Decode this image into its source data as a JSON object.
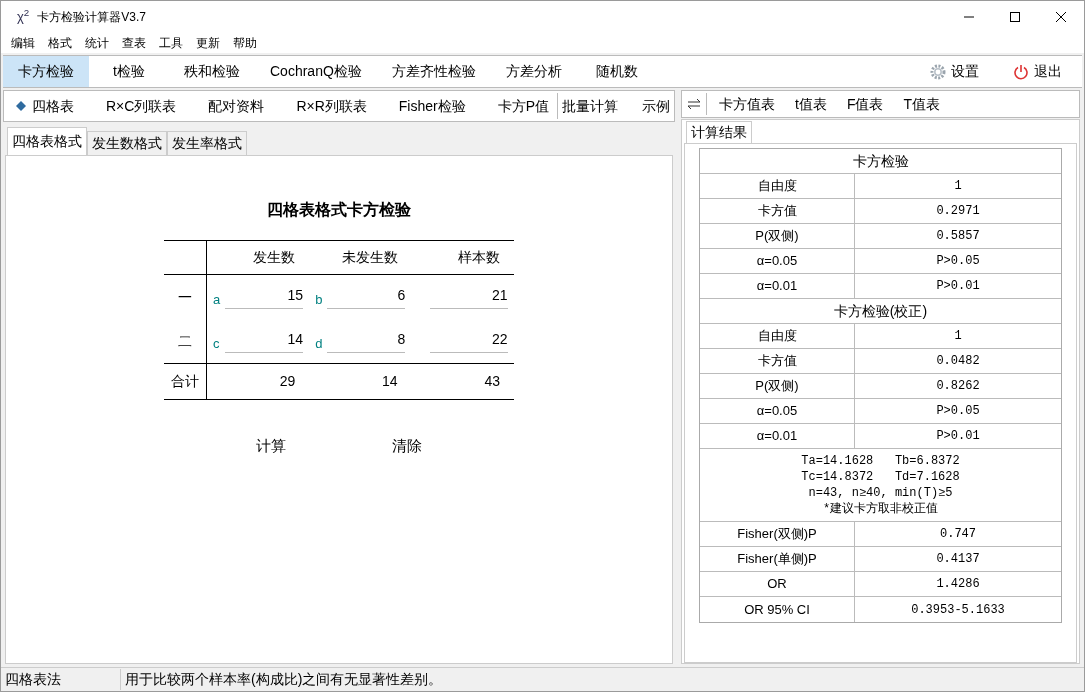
{
  "window": {
    "icon": "χ$^{2}$",
    "title": "卡方检验计算器V3.7"
  },
  "menu": [
    "编辑",
    "格式",
    "统计",
    "查表",
    "工具",
    "更新",
    "帮助"
  ],
  "main_tabs": [
    {
      "label": "卡方检验",
      "selected": true
    },
    {
      "label": "t检验",
      "selected": false
    },
    {
      "label": "秩和检验",
      "selected": false
    },
    {
      "label": "CochranQ检验",
      "selected": false
    },
    {
      "label": "方差齐性检验",
      "selected": false
    },
    {
      "label": "方差分析",
      "selected": false
    },
    {
      "label": "随机数",
      "selected": false
    }
  ],
  "actions": [
    {
      "kind": "settings",
      "label": "设置"
    },
    {
      "kind": "exit",
      "label": "退出"
    }
  ],
  "sub_tabs": [
    {
      "label": "四格表",
      "selected": true
    },
    {
      "label": "R×C列联表",
      "selected": false
    },
    {
      "label": "配对资料",
      "selected": false
    },
    {
      "label": "R×R列联表",
      "selected": false
    },
    {
      "label": "Fisher检验",
      "selected": false
    },
    {
      "label": "卡方P值",
      "selected": false
    }
  ],
  "extra_tabs": [
    "批量计算",
    "示例"
  ],
  "format_tabs": [
    {
      "label": "四格表格式",
      "selected": true
    },
    {
      "label": "发生数格式",
      "selected": false
    },
    {
      "label": "发生率格式",
      "selected": false
    }
  ],
  "form": {
    "title": "四格表格式卡方检验",
    "columns": [
      "发生数",
      "未发生数",
      "样本数"
    ],
    "rows": [
      {
        "label": "一",
        "cells": [
          {
            "tag": "a",
            "value": "15"
          },
          {
            "tag": "b",
            "value": "6"
          },
          {
            "value": "21"
          }
        ]
      },
      {
        "label": "二",
        "cells": [
          {
            "tag": "c",
            "value": "14"
          },
          {
            "tag": "d",
            "value": "8"
          },
          {
            "value": "22"
          }
        ]
      }
    ],
    "total": {
      "label": "合计",
      "values": [
        "29",
        "14",
        "43"
      ]
    },
    "buttons": [
      "计算",
      "清除"
    ]
  },
  "table_tabs": [
    "卡方值表",
    "t值表",
    "F值表",
    "T值表"
  ],
  "result_tabs": [
    {
      "label": "计算结果",
      "selected": true
    }
  ],
  "results": [
    {
      "kind": "header",
      "text": "卡方检验"
    },
    {
      "kind": "pair",
      "label": "自由度",
      "value": "1"
    },
    {
      "kind": "pair",
      "label": "卡方值",
      "value": "0.2971"
    },
    {
      "kind": "pair",
      "label": "P(双侧)",
      "value": "0.5857"
    },
    {
      "kind": "pair",
      "label": "α=0.05",
      "value": "P>0.05"
    },
    {
      "kind": "pair",
      "label": "α=0.01",
      "value": "P>0.01"
    },
    {
      "kind": "header",
      "text": "卡方检验(校正)"
    },
    {
      "kind": "pair",
      "label": "自由度",
      "value": "1"
    },
    {
      "kind": "pair",
      "label": "卡方值",
      "value": "0.0482"
    },
    {
      "kind": "pair",
      "label": "P(双侧)",
      "value": "0.8262"
    },
    {
      "kind": "pair",
      "label": "α=0.05",
      "value": "P>0.05"
    },
    {
      "kind": "pair",
      "label": "α=0.01",
      "value": "P>0.01"
    },
    {
      "kind": "note",
      "lines": [
        "Ta=14.1628   Tb=6.8372",
        "Tc=14.8372   Td=7.1628",
        "n=43, n≥40, min(T)≥5",
        "*建议卡方取非校正值"
      ]
    },
    {
      "kind": "pair",
      "label": "Fisher(双侧)P",
      "value": "0.747"
    },
    {
      "kind": "pair",
      "label": "Fisher(单侧)P",
      "value": "0.4137"
    },
    {
      "kind": "pair",
      "label": "OR",
      "value": "1.4286"
    },
    {
      "kind": "pair",
      "label": "OR 95% CI",
      "value": "0.3953-5.1633"
    }
  ],
  "status_bar": [
    "四格表法",
    "用于比较两个样本率(构成比)之间有无显著性差别。"
  ]
}
